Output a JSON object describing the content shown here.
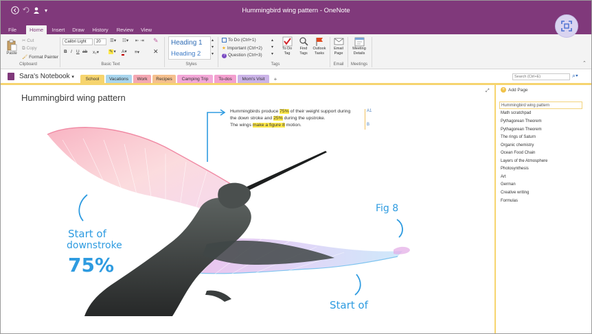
{
  "window": {
    "title": "Hummingbird wing pattern - OneNote"
  },
  "menu": {
    "tabs": [
      "File",
      "Home",
      "Insert",
      "Draw",
      "History",
      "Review",
      "View"
    ],
    "active": "Home"
  },
  "ribbon": {
    "clipboard": {
      "paste": "Paste",
      "cut": "Cut",
      "copy": "Copy",
      "format_painter": "Format Painter",
      "label": "Clipboard"
    },
    "basic_text": {
      "font": "Calibri Light",
      "size": "20",
      "label": "Basic Text"
    },
    "styles": {
      "heading1": "Heading 1",
      "heading2": "Heading 2",
      "label": "Styles"
    },
    "tags": {
      "todo": "To Do (Ctrl+1)",
      "important": "Important (Ctrl+2)",
      "question": "Question (Ctrl+3)",
      "todo_tag": "To Do Tag",
      "find_tags": "Find Tags",
      "outlook_tasks": "Outlook Tasks",
      "label": "Tags"
    },
    "email": {
      "email_page": "Email Page",
      "label": "Email"
    },
    "meetings": {
      "meeting_details": "Meeting Details",
      "label": "Meetings"
    }
  },
  "notebook": {
    "name": "Sara's Notebook",
    "sections": [
      {
        "label": "School",
        "color": "#f6d46e"
      },
      {
        "label": "Vacations",
        "color": "#a9d6ee"
      },
      {
        "label": "Work",
        "color": "#f4a8b3"
      },
      {
        "label": "Recipes",
        "color": "#f5c08e"
      },
      {
        "label": "Camping Trip",
        "color": "#f3a8d8"
      },
      {
        "label": "To-dos",
        "color": "#f3a0cf"
      },
      {
        "label": "Mom's Visit",
        "color": "#cbb4e8"
      }
    ],
    "add_section": "+"
  },
  "search": {
    "placeholder": "Search (Ctrl+E)"
  },
  "page": {
    "title": "Hummingbird wing pattern",
    "note_line1_pre": "Hummingbirds produce ",
    "note_hl1": "75%",
    "note_line1_post": " of their weight support during",
    "note_line2_pre": "the down stroke and ",
    "note_hl2": "25%",
    "note_line2_post": " during the upstroke.",
    "note_line3_pre": "The wings ",
    "note_hl3": "make a figure 8",
    "note_line3_post": " motion.",
    "side_mark_1": "A1",
    "side_mark_2": "B"
  },
  "ink": {
    "start_of": "Start of",
    "downstroke": "downstroke",
    "percent": "75%",
    "fig8": "Fig 8",
    "start_of_2": "Start of"
  },
  "pages": {
    "add_page": "Add Page",
    "items": [
      "Hummingbird wing pattern",
      "Math scratchpad",
      "Pythagorean Theorem",
      "Pythagorean Theorem",
      "The rings of Saturn",
      "Organic chemistry",
      "Ocean Food Chain",
      "Layers of the Atmosphere",
      "Photosynthesis",
      "Art",
      "German",
      "Creative writing",
      "Formulas"
    ]
  },
  "colors": {
    "brand": "#80397b",
    "section_active": "#f6d46e",
    "ink": "#2e9be0",
    "highlight": "#ffe94a"
  }
}
